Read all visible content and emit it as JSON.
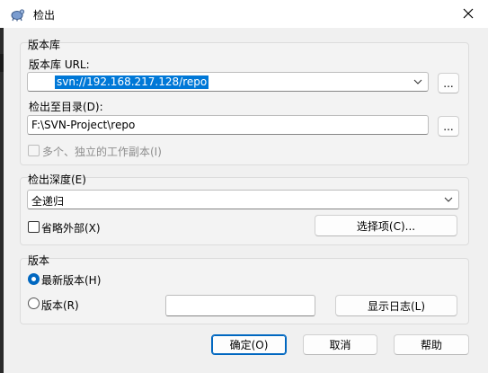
{
  "window": {
    "title": "检出"
  },
  "repo_group": {
    "title": "版本库",
    "url_label": "版本库 URL:",
    "url_value": "svn://192.168.217.128/repo",
    "url_browse": "...",
    "dir_label": "检出至目录(D):",
    "dir_value": "F:\\SVN-Project\\repo",
    "dir_browse": "...",
    "multi_label": "多个、独立的工作副本(I)"
  },
  "depth_group": {
    "title": "检出深度(E)",
    "depth_value": "全递归",
    "omit_externals_label": "省略外部(X)",
    "choose_items_button": "选择项(C)..."
  },
  "revision_group": {
    "title": "版本",
    "head_label": "最新版本(H)",
    "revision_label": "版本(R)",
    "revision_value": "",
    "show_log_button": "显示日志(L)"
  },
  "footer": {
    "ok_button": "确定(O)",
    "cancel_button": "取消",
    "help_button": "帮助"
  },
  "colors": {
    "accent": "#0067c0",
    "selection": "#0078d7"
  }
}
